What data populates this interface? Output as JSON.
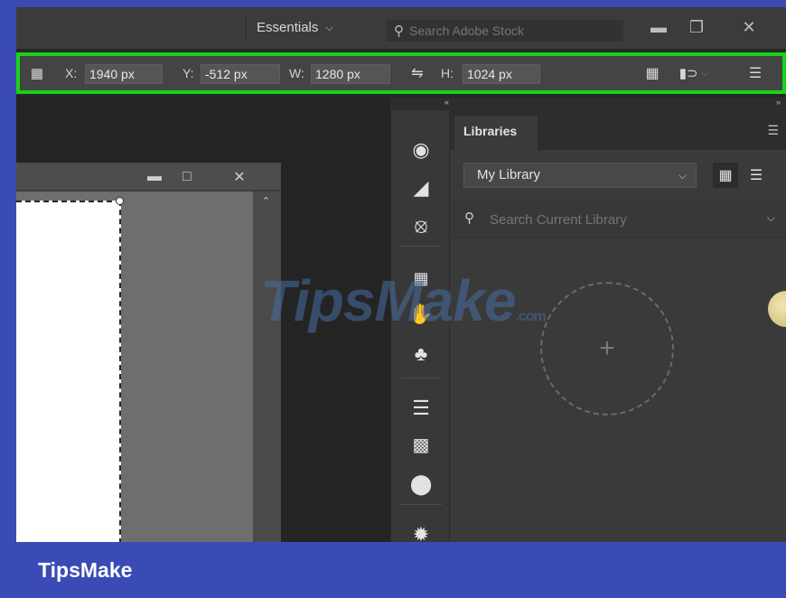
{
  "titlebar": {
    "workspace_label": "Essentials",
    "stock_search_placeholder": "Search Adobe Stock"
  },
  "options_bar": {
    "x_label": "X:",
    "x_value": "1940 px",
    "y_label": "Y:",
    "y_value": "-512 px",
    "w_label": "W:",
    "w_value": "1280 px",
    "h_label": "H:",
    "h_value": "1024 px",
    "highlight_color": "#17d317"
  },
  "strip": {
    "left_arrows": "«",
    "right_arrows": "»"
  },
  "dock": {
    "icons": [
      "color-palette-icon",
      "swatches-icon",
      "paths-icon",
      "layers-grid-icon",
      "hand-puppet-icon",
      "club-icon",
      "paragraph-icon",
      "gradient-icon",
      "shapes-icon",
      "brush-icon"
    ]
  },
  "libraries": {
    "tab_label": "Libraries",
    "selected_library": "My Library",
    "search_placeholder": "Search Current Library",
    "add_symbol": "+"
  },
  "watermark": {
    "text": "TipsMake",
    "suffix": ".com"
  },
  "footer": {
    "brand": "TipsMake"
  }
}
